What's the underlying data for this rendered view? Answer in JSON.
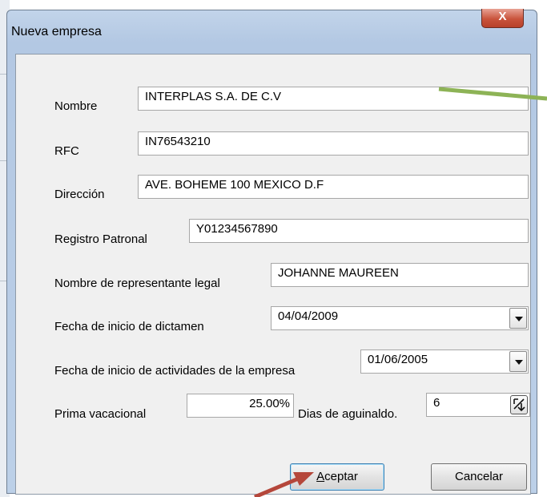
{
  "dialog": {
    "title": "Nueva empresa",
    "close_symbol": "X"
  },
  "form": {
    "nombre": {
      "label": "Nombre",
      "value": "INTERPLAS S.A. DE C.V"
    },
    "rfc": {
      "label": "RFC",
      "value": "IN76543210"
    },
    "direccion": {
      "label": "Dirección",
      "value": "AVE. BOHEME  100  MEXICO D.F"
    },
    "registro": {
      "label": "Registro Patronal",
      "value": "Y01234567890"
    },
    "representante": {
      "label": "Nombre de representante legal",
      "value": "JOHANNE MAUREEN"
    },
    "fecha_dictamen": {
      "label": "Fecha de inicio de dictamen",
      "value": "04/04/2009"
    },
    "fecha_actividades": {
      "label": "Fecha de inicio de actividades de la empresa",
      "value": "01/06/2005"
    },
    "prima": {
      "label": "Prima vacacional",
      "value": "25.00%"
    },
    "aguinaldo": {
      "label": "Dias de aguinaldo.",
      "value": "6"
    }
  },
  "buttons": {
    "accept_first": "A",
    "accept_rest": "ceptar",
    "cancel": "Cancelar"
  },
  "annotation_colors": {
    "green_arrow": "#8db356",
    "red_arrow": "#b5473b"
  }
}
